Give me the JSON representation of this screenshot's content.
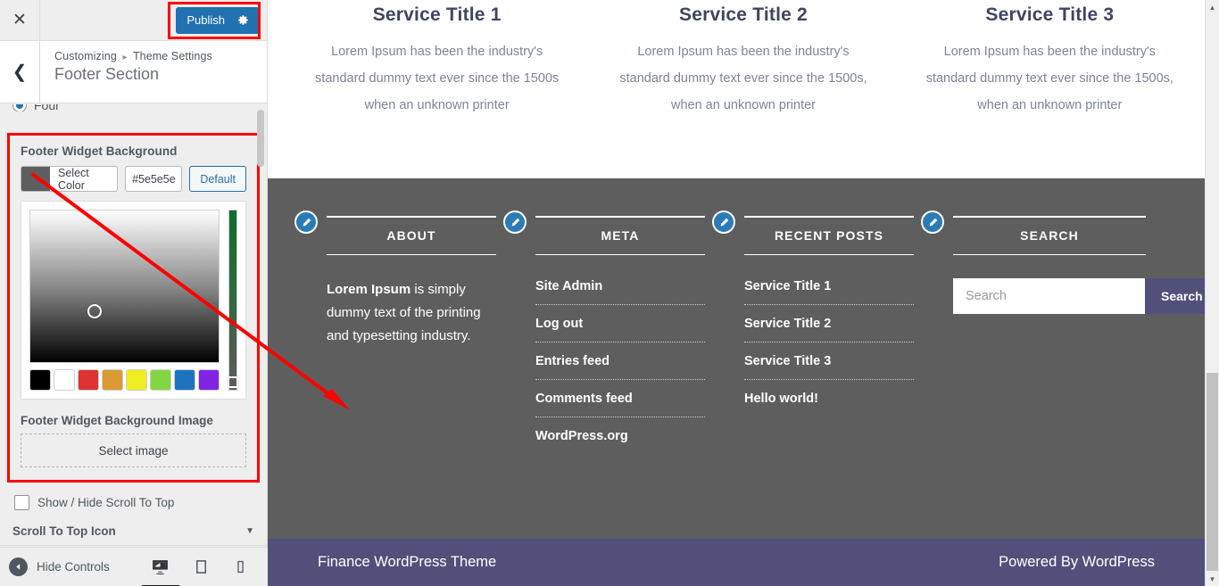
{
  "customizer": {
    "close_icon": "close-icon",
    "publish_label": "Publish",
    "gear_icon": "gear-icon",
    "back_icon": "chevron-left-icon",
    "breadcrumb_root": "Customizing",
    "breadcrumb_sep": "▸",
    "breadcrumb_parent": "Theme Settings",
    "panel_title": "Footer Section",
    "partial_radio_label": "Four",
    "accent_blue": "#2271b1",
    "highlight_red": "#ff0000",
    "controls": {
      "bg_label": "Footer Widget Background",
      "select_color_label": "Select Color",
      "hex_value": "#5e5e5e",
      "default_label": "Default",
      "swatch_color": "#5e5e5e",
      "palette": [
        "#000000",
        "#ffffff",
        "#dd3333",
        "#dd9933",
        "#eeee22",
        "#81d742",
        "#1e73be",
        "#8224e3"
      ],
      "bg_image_label": "Footer Widget Background Image",
      "select_image_label": "Select image",
      "scroll_top_checkbox_label": "Show / Hide Scroll To Top",
      "scroll_top_icon_section": "Scroll To Top Icon",
      "caret_icon": "chevron-down-icon"
    },
    "footer": {
      "hide_controls_label": "Hide Controls",
      "hide_icon": "collapse-arrow-icon",
      "devices": [
        {
          "name": "desktop-preview-icon",
          "active": true
        },
        {
          "name": "tablet-preview-icon",
          "active": false
        },
        {
          "name": "mobile-preview-icon",
          "active": false
        }
      ]
    }
  },
  "preview": {
    "services": [
      {
        "title": "Service Title 1",
        "text": "Lorem Ipsum has been the industry's standard dummy text ever since the 1500s when an unknown printer"
      },
      {
        "title": "Service Title 2",
        "text": "Lorem Ipsum has been the industry's standard dummy text ever since the 1500s, when an unknown printer"
      },
      {
        "title": "Service Title 3",
        "text": "Lorem Ipsum has been the industry's standard dummy text ever since the 1500s, when an unknown printer"
      }
    ],
    "widget_bg_color": "#5e5e5e",
    "widgets": {
      "about": {
        "heading": "ABOUT",
        "edit_icon": "edit-pencil-icon",
        "strong": "Lorem Ipsum",
        "rest": " is simply dummy text of the printing and typesetting industry."
      },
      "meta": {
        "heading": "META",
        "edit_icon": "edit-pencil-icon",
        "items": [
          "Site Admin",
          "Log out",
          "Entries feed",
          "Comments feed",
          "WordPress.org"
        ]
      },
      "recent": {
        "heading": "RECENT POSTS",
        "edit_icon": "edit-pencil-icon",
        "items": [
          "Service Title 1",
          "Service Title 2",
          "Service Title 3",
          "Hello world!"
        ]
      },
      "search": {
        "heading": "SEARCH",
        "edit_icon": "edit-pencil-icon",
        "placeholder": "Search",
        "button_label": "Search",
        "button_color": "#51507a"
      }
    },
    "bottom_bar": {
      "left": "Finance WordPress Theme",
      "right": "Powered By WordPress",
      "bg_color": "#51507a"
    }
  }
}
